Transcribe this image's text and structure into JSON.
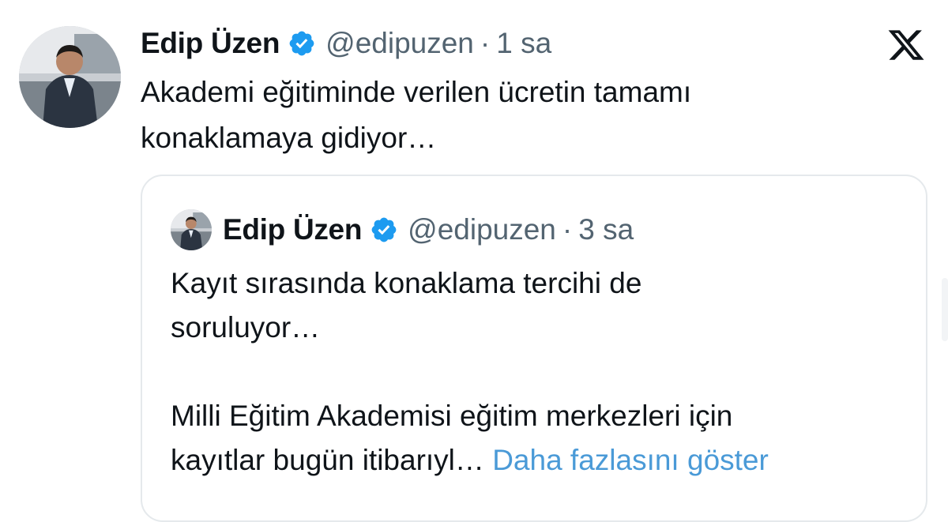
{
  "tweet": {
    "author": {
      "name": "Edip Üzen",
      "handle": "@edipuzen",
      "verified": true
    },
    "separator": "·",
    "time": "1 sa",
    "text_line1": "Akademi eğitiminde verilen ücretin tamamı",
    "text_line2": "konaklamaya gidiyor…"
  },
  "quoted_tweet": {
    "author": {
      "name": "Edip Üzen",
      "handle": "@edipuzen",
      "verified": true
    },
    "separator": "·",
    "time": "3 sa",
    "text_line1": "Kayıt sırasında konaklama tercihi de",
    "text_line2": "soruluyor…",
    "text_line3": "Milli Eğitim Akademisi eğitim merkezleri için",
    "text_line4": "kayıtlar bugün itibarıyl…",
    "show_more": "Daha fazlasını göster"
  },
  "icons": {
    "verified": "verified-badge-icon",
    "platform": "x-logo-icon"
  },
  "colors": {
    "text": "#0f1419",
    "secondary": "#536471",
    "link": "#4a9ad7",
    "verified": "#1d9bf0",
    "border": "#e5e9ec"
  }
}
